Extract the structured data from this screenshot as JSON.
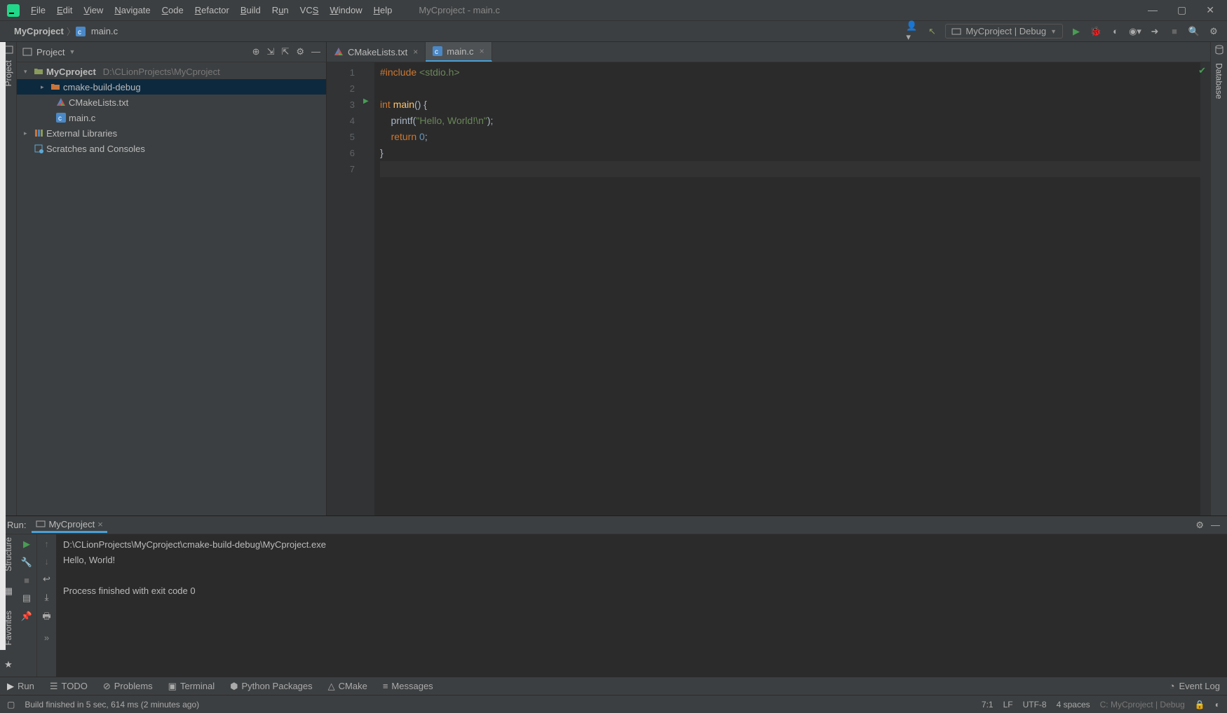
{
  "window": {
    "title": "MyCproject - main.c"
  },
  "menu": {
    "items": [
      "File",
      "Edit",
      "View",
      "Navigate",
      "Code",
      "Refactor",
      "Build",
      "Run",
      "VCS",
      "Window",
      "Help"
    ]
  },
  "breadcrumb": {
    "project": "MyCproject",
    "file": "main.c"
  },
  "run_config": {
    "label": "MyCproject | Debug"
  },
  "project_panel": {
    "title": "Project",
    "root": {
      "name": "MyCproject",
      "path": "D:\\CLionProjects\\MyCproject"
    },
    "children": [
      "cmake-build-debug",
      "CMakeLists.txt",
      "main.c"
    ],
    "libs": "External Libraries",
    "scratch": "Scratches and Consoles"
  },
  "tabs": [
    {
      "name": "CMakeLists.txt",
      "active": false
    },
    {
      "name": "main.c",
      "active": true
    }
  ],
  "code_lines": {
    "l1a": "#include",
    "l1b": " <stdio.h>",
    "l3a": "int",
    "l3b": " ",
    "l3c": "main",
    "l3d": "() {",
    "l4a": "    printf(",
    "l4b": "\"Hello, World!\\n\"",
    "l4c": ");",
    "l5a": "    ",
    "l5b": "return ",
    "l5c": "0",
    "l5d": ";",
    "l6": "}"
  },
  "line_numbers": [
    "1",
    "2",
    "3",
    "4",
    "5",
    "6",
    "7"
  ],
  "run": {
    "title": "Run:",
    "tab": "MyCproject",
    "output_path": "D:\\CLionProjects\\MyCproject\\cmake-build-debug\\MyCproject.exe",
    "output_hello": "Hello, World!",
    "output_exit": "Process finished with exit code 0"
  },
  "left_strip": {
    "structure": "Structure",
    "favorites": "Favorites"
  },
  "right_strip": {
    "database": "Database"
  },
  "bottom_tabs": {
    "run": "Run",
    "todo": "TODO",
    "problems": "Problems",
    "terminal": "Terminal",
    "python": "Python Packages",
    "cmake": "CMake",
    "messages": "Messages",
    "eventlog": "Event Log"
  },
  "status": {
    "build": "Build finished in 5 sec, 614 ms (2 minutes ago)",
    "pos": "7:1",
    "le": "LF",
    "enc": "UTF-8",
    "indent": "4 spaces",
    "ctx": "C: MyCproject | Debug"
  },
  "colors": {
    "accent": "#48a0d8",
    "run_green": "#499c54"
  }
}
